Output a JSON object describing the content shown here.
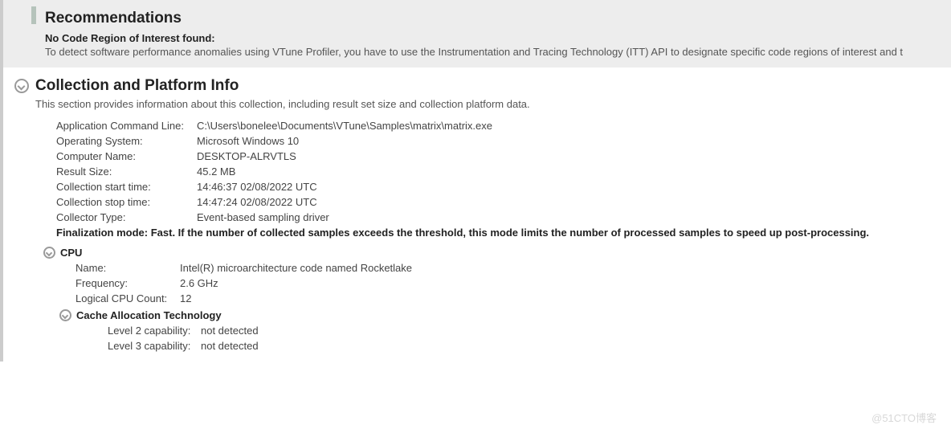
{
  "recommendations": {
    "heading": "Recommendations",
    "sub_heading": "No Code Region of Interest found:",
    "body": "To detect software performance anomalies using VTune Profiler, you have to use the Instrumentation and Tracing Technology (ITT) API to designate specific code regions of interest and t"
  },
  "collection": {
    "title": "Collection and Platform Info",
    "desc": "This section provides information about this collection, including result set size and collection platform data.",
    "rows": [
      {
        "k": "Application Command Line:",
        "v": "C:\\Users\\bonelee\\Documents\\VTune\\Samples\\matrix\\matrix.exe"
      },
      {
        "k": "Operating System:",
        "v": "Microsoft Windows 10"
      },
      {
        "k": "Computer Name:",
        "v": "DESKTOP-ALRVTLS"
      },
      {
        "k": "Result Size:",
        "v": "45.2 MB"
      },
      {
        "k": "Collection start time:",
        "v": "14:46:37 02/08/2022 UTC"
      },
      {
        "k": "Collection stop time:",
        "v": "14:47:24 02/08/2022 UTC"
      },
      {
        "k": "Collector Type:",
        "v": "Event-based sampling driver"
      }
    ],
    "finalization": "Finalization mode: Fast. If the number of collected samples exceeds the threshold, this mode limits the number of processed samples to speed up post-processing."
  },
  "cpu": {
    "title": "CPU",
    "rows": [
      {
        "k": "Name:",
        "v": "Intel(R) microarchitecture code named Rocketlake"
      },
      {
        "k": "Frequency:",
        "v": "2.6 GHz"
      },
      {
        "k": "Logical CPU Count:",
        "v": "12"
      }
    ]
  },
  "cat": {
    "title": "Cache Allocation Technology",
    "rows": [
      {
        "k": "Level 2 capability:",
        "v": "not detected"
      },
      {
        "k": "Level 3 capability:",
        "v": "not detected"
      }
    ]
  },
  "watermark": "@51CTO博客"
}
